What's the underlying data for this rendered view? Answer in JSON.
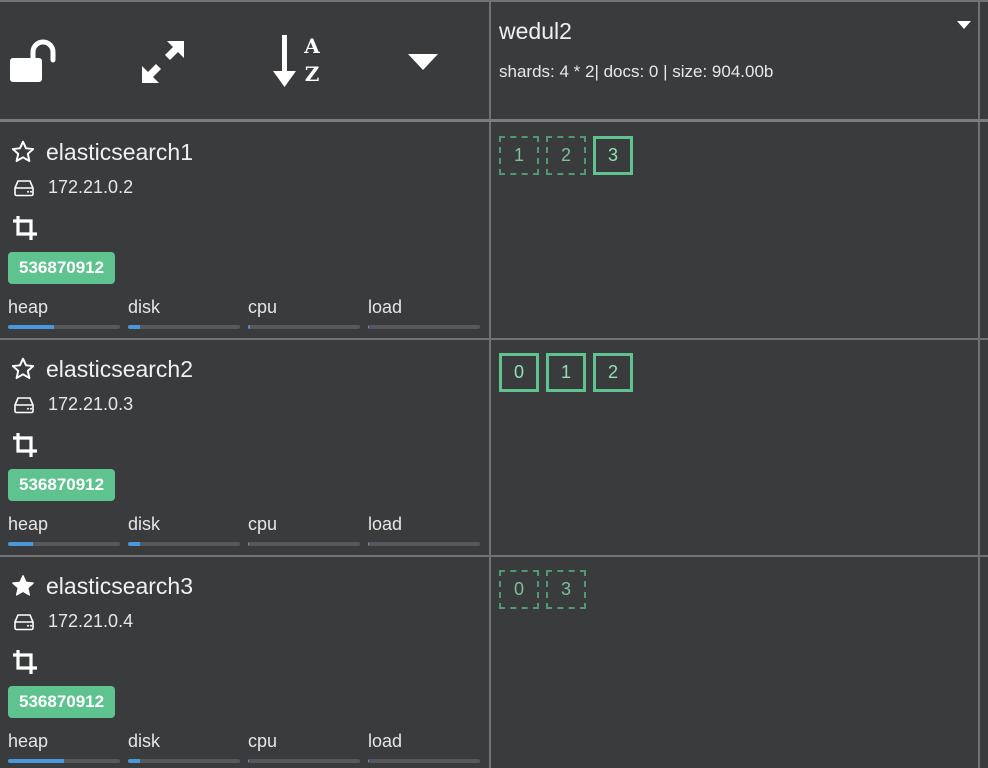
{
  "toolbar": {
    "icons": [
      "unlock-icon",
      "expand-icon",
      "sort-alpha-icon",
      "caret-down-icon"
    ]
  },
  "index": {
    "name": "wedul2",
    "stats": "shards: 4 * 2| docs: 0 | size: 904.00b"
  },
  "metric_labels": {
    "heap": "heap",
    "disk": "disk",
    "cpu": "cpu",
    "load": "load"
  },
  "nodes": [
    {
      "name": "elasticsearch1",
      "ip": "172.21.0.2",
      "badge": "536870912",
      "master": false,
      "metrics": {
        "heap": 0.41,
        "disk": 0.11,
        "cpu": 0.02,
        "load": 0.01
      },
      "shards": [
        {
          "label": "1",
          "state": "replica"
        },
        {
          "label": "2",
          "state": "replica"
        },
        {
          "label": "3",
          "state": "primary"
        }
      ]
    },
    {
      "name": "elasticsearch2",
      "ip": "172.21.0.3",
      "badge": "536870912",
      "master": false,
      "metrics": {
        "heap": 0.22,
        "disk": 0.11,
        "cpu": 0.01,
        "load": 0.01
      },
      "shards": [
        {
          "label": "0",
          "state": "primary"
        },
        {
          "label": "1",
          "state": "primary"
        },
        {
          "label": "2",
          "state": "primary"
        }
      ]
    },
    {
      "name": "elasticsearch3",
      "ip": "172.21.0.4",
      "badge": "536870912",
      "master": true,
      "metrics": {
        "heap": 0.5,
        "disk": 0.11,
        "cpu": 0.01,
        "load": 0.01
      },
      "shards": [
        {
          "label": "0",
          "state": "replica"
        },
        {
          "label": "3",
          "state": "replica"
        }
      ]
    }
  ],
  "colors": {
    "background": "#3a3b3d",
    "grid": "#707274",
    "badge": "#5ec38e",
    "shard": "#5ec38e",
    "metric_fill": "#4a97dc"
  }
}
